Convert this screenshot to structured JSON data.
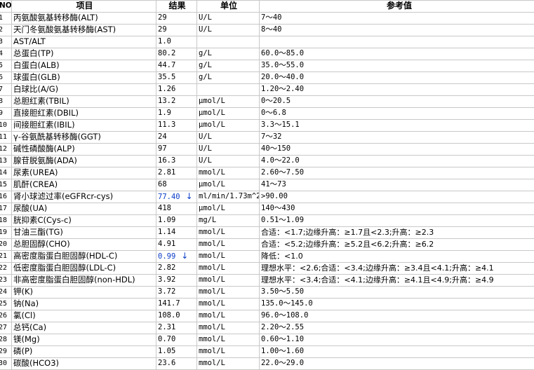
{
  "headers": {
    "no": "NO.",
    "item": "项目",
    "result": "结果",
    "unit": "单位",
    "reference": "参考值"
  },
  "rows": [
    {
      "no": "1",
      "item": "丙氨酸氨基转移酶(ALT)",
      "result": "29",
      "flag": "",
      "unit": "U/L",
      "reference": "7～40"
    },
    {
      "no": "2",
      "item": "天门冬氨酸氨基转移酶(AST)",
      "result": "29",
      "flag": "",
      "unit": "U/L",
      "reference": "8～40"
    },
    {
      "no": "3",
      "item": "AST/ALT",
      "result": "1.0",
      "flag": "",
      "unit": "",
      "reference": ""
    },
    {
      "no": "4",
      "item": "总蛋白(TP)",
      "result": "80.2",
      "flag": "",
      "unit": "g/L",
      "reference": "60.0～85.0"
    },
    {
      "no": "5",
      "item": "白蛋白(ALB)",
      "result": "44.7",
      "flag": "",
      "unit": "g/L",
      "reference": "35.0～55.0"
    },
    {
      "no": "6",
      "item": "球蛋白(GLB)",
      "result": "35.5",
      "flag": "",
      "unit": "g/L",
      "reference": "20.0～40.0"
    },
    {
      "no": "7",
      "item": "白球比(A/G)",
      "result": "1.26",
      "flag": "",
      "unit": "",
      "reference": "1.20～2.40"
    },
    {
      "no": "8",
      "item": "总胆红素(TBIL)",
      "result": "13.2",
      "flag": "",
      "unit": "μmol/L",
      "reference": "0～20.5"
    },
    {
      "no": "9",
      "item": "直接胆红素(DBIL)",
      "result": "1.9",
      "flag": "",
      "unit": "μmol/L",
      "reference": "0～6.8"
    },
    {
      "no": "10",
      "item": "间接胆红素(IBIL)",
      "result": "11.3",
      "flag": "",
      "unit": "μmol/L",
      "reference": "3.3～15.1"
    },
    {
      "no": "11",
      "item": "γ-谷氨酰基转移酶(GGT)",
      "result": "24",
      "flag": "",
      "unit": "U/L",
      "reference": "7～32"
    },
    {
      "no": "12",
      "item": "碱性磷酸酶(ALP)",
      "result": "97",
      "flag": "",
      "unit": "U/L",
      "reference": "40～150"
    },
    {
      "no": "13",
      "item": "腺苷脱氨酶(ADA)",
      "result": "16.3",
      "flag": "",
      "unit": "U/L",
      "reference": "4.0～22.0"
    },
    {
      "no": "14",
      "item": "尿素(UREA)",
      "result": "2.81",
      "flag": "",
      "unit": "mmol/L",
      "reference": "2.60～7.50"
    },
    {
      "no": "15",
      "item": "肌酐(CREA)",
      "result": "68",
      "flag": "",
      "unit": "μmol/L",
      "reference": "41～73"
    },
    {
      "no": "16",
      "item": "肾小球滤过率(eGFRcr-cys)",
      "result": "77.40",
      "flag": "↓",
      "unit": "ml/min/1.73m^2",
      "reference": ">90.00"
    },
    {
      "no": "17",
      "item": "尿酸(UA)",
      "result": "418",
      "flag": "",
      "unit": "μmol/L",
      "reference": "140～430"
    },
    {
      "no": "18",
      "item": "胱抑素C(Cys-c)",
      "result": "1.09",
      "flag": "",
      "unit": "mg/L",
      "reference": "0.51～1.09"
    },
    {
      "no": "19",
      "item": "甘油三酯(TG)",
      "result": "1.14",
      "flag": "",
      "unit": "mmol/L",
      "reference": "合适：<1.7;边缘升高：≥1.7且<2.3;升高：≥2.3"
    },
    {
      "no": "20",
      "item": "总胆固醇(CHO)",
      "result": "4.91",
      "flag": "",
      "unit": "mmol/L",
      "reference": "合适：<5.2;边缘升高：≥5.2且<6.2;升高：≥6.2"
    },
    {
      "no": "21",
      "item": "高密度脂蛋白胆固醇(HDL-C)",
      "result": "0.99",
      "flag": "↓",
      "unit": "mmol/L",
      "reference": "降低：<1.0"
    },
    {
      "no": "22",
      "item": "低密度脂蛋白胆固醇(LDL-C)",
      "result": "2.82",
      "flag": "",
      "unit": "mmol/L",
      "reference": "理想水平：<2.6;合适：<3.4;边缘升高：≥3.4且<4.1;升高：≥4.1"
    },
    {
      "no": "23",
      "item": "非高密度脂蛋白胆固醇(non-HDL)",
      "result": "3.92",
      "flag": "",
      "unit": "mmol/L",
      "reference": "理想水平：<3.4;合适：<4.1;边缘升高：≥4.1且<4.9;升高：≥4.9"
    },
    {
      "no": "24",
      "item": "钾(K)",
      "result": "3.72",
      "flag": "",
      "unit": "mmol/L",
      "reference": "3.50～5.50"
    },
    {
      "no": "25",
      "item": "钠(Na)",
      "result": "141.7",
      "flag": "",
      "unit": "mmol/L",
      "reference": "135.0～145.0"
    },
    {
      "no": "26",
      "item": "氯(Cl)",
      "result": "108.0",
      "flag": "",
      "unit": "mmol/L",
      "reference": "96.0～108.0"
    },
    {
      "no": "27",
      "item": "总钙(Ca)",
      "result": "2.31",
      "flag": "",
      "unit": "mmol/L",
      "reference": "2.20～2.55"
    },
    {
      "no": "28",
      "item": "镁(Mg)",
      "result": "0.70",
      "flag": "",
      "unit": "mmol/L",
      "reference": "0.60～1.10"
    },
    {
      "no": "29",
      "item": "磷(P)",
      "result": "1.05",
      "flag": "",
      "unit": "mmol/L",
      "reference": "1.00～1.60"
    },
    {
      "no": "30",
      "item": "碳酸(HCO3)",
      "result": "23.6",
      "flag": "",
      "unit": "mmol/L",
      "reference": "22.0～29.0"
    }
  ],
  "colors": {
    "border": "#c8c8c8",
    "abnormal": "#0a3cc8"
  },
  "icons": {
    "low_flag": "arrow-down-icon"
  }
}
